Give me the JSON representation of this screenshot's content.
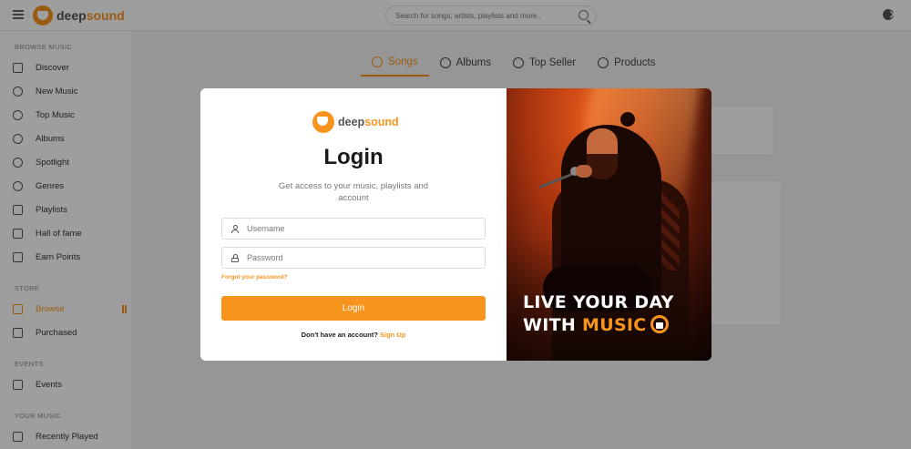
{
  "header": {
    "brand_deep": "deep",
    "brand_sound": "sound",
    "search_placeholder": "Search for songs, artists, playlists and more.."
  },
  "sidebar": {
    "browse_heading": "BROWSE MUSIC",
    "browse_items": [
      "Discover",
      "New Music",
      "Top Music",
      "Albums",
      "Spotlight",
      "Genres",
      "Playlists",
      "Hall of fame",
      "Earn Points"
    ],
    "store_heading": "STORE",
    "store_items": [
      "Browse",
      "Purchased"
    ],
    "events_heading": "EVENTS",
    "events_items": [
      "Events"
    ],
    "your_music_heading": "YOUR MUSIC",
    "your_music_items": [
      "Recently Played"
    ],
    "active_item": "Browse"
  },
  "tabs": [
    "Songs",
    "Albums",
    "Top Seller",
    "Products"
  ],
  "active_tab": "Songs",
  "modal": {
    "brand_deep": "deep",
    "brand_sound": "sound",
    "title": "Login",
    "subtitle": "Get access to your music, playlists and account",
    "username_placeholder": "Username",
    "password_placeholder": "Password",
    "forgot": "Forgot your password?",
    "login_button": "Login",
    "no_account": "Don't have an account?",
    "signup": "Sign Up",
    "slogan_line1": "LIVE YOUR DAY",
    "slogan_with": "WITH",
    "slogan_music": "MUSIC"
  },
  "colors": {
    "accent": "#f7941d",
    "overlay": "rgba(0,0,0,0.38)"
  }
}
